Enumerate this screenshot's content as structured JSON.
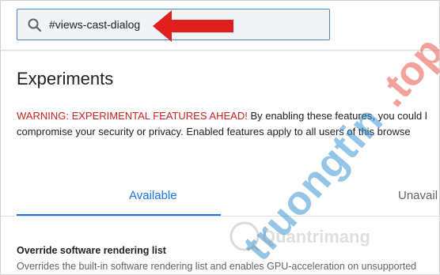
{
  "search": {
    "value": "#views-cast-dialog",
    "icon": "search-icon"
  },
  "page": {
    "title": "Experiments"
  },
  "warning": {
    "highlight": "WARNING: EXPERIMENTAL FEATURES AHEAD!",
    "line1_rest": " By enabling these features, you could l",
    "line2": "compromise your security or privacy. Enabled features apply to all users of this browse"
  },
  "tabs": [
    {
      "label": "Available",
      "active": true
    },
    {
      "label": "Unavail",
      "active": false
    }
  ],
  "experiment": {
    "name": "Override software rendering list",
    "description": "Overrides the built-in software rendering list and enables GPU-acceleration on unsupported"
  },
  "annotation": {
    "arrow_color": "#e0201e",
    "icon": "arrow-left-icon"
  },
  "watermark": {
    "brand": "truongtin",
    "brand_tld": ".top",
    "secondary": "Quantrimang",
    "brand_color": "#1a84c8",
    "accent_color": "#e8483a"
  },
  "colors": {
    "accent": "#1a73e8",
    "warning_red": "#c5221f",
    "search_border": "#4a89c8"
  }
}
